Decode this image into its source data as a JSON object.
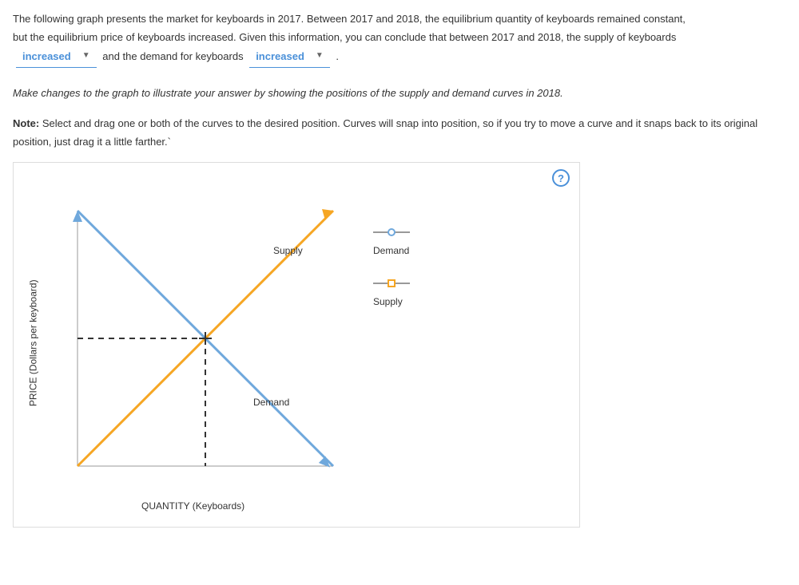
{
  "intro": {
    "p1a": "The following graph presents the market for keyboards in 2017. Between 2017 and 2018, the equilibrium quantity of keyboards remained constant,",
    "p1b": "but the equilibrium price of keyboards increased. Given this information, you can conclude that between 2017 and 2018, the supply of keyboards",
    "blank1_value": "increased",
    "mid": " and the demand for keyboards ",
    "blank2_value": "increased",
    "tail": " ."
  },
  "instruction": "Make changes to the graph to illustrate your answer by showing the positions of the supply and demand curves in 2018.",
  "note_bold": "Note:",
  "note_text": " Select and drag one or both of the curves to the desired position. Curves will snap into position, so if you try to move a curve and it snaps back to its original position, just drag it a little farther.`",
  "help": "?",
  "chart": {
    "ylabel": "PRICE (Dollars per keyboard)",
    "xlabel": "QUANTITY (Keyboards)",
    "supply_label": "Supply",
    "demand_label": "Demand"
  },
  "legend": {
    "demand": "Demand",
    "supply": "Supply"
  },
  "chart_data": {
    "type": "line",
    "title": "",
    "xlabel": "QUANTITY (Keyboards)",
    "ylabel": "PRICE (Dollars per keyboard)",
    "xlim": [
      0,
      10
    ],
    "ylim": [
      0,
      10
    ],
    "series": [
      {
        "name": "Demand",
        "x": [
          0,
          10
        ],
        "y": [
          10,
          0
        ],
        "color": "#6fa8dc"
      },
      {
        "name": "Supply",
        "x": [
          0,
          10
        ],
        "y": [
          0,
          10
        ],
        "color": "#f6a623"
      }
    ],
    "equilibrium": {
      "x": 5,
      "y": 5
    },
    "legend_position": "right",
    "grid": false
  }
}
